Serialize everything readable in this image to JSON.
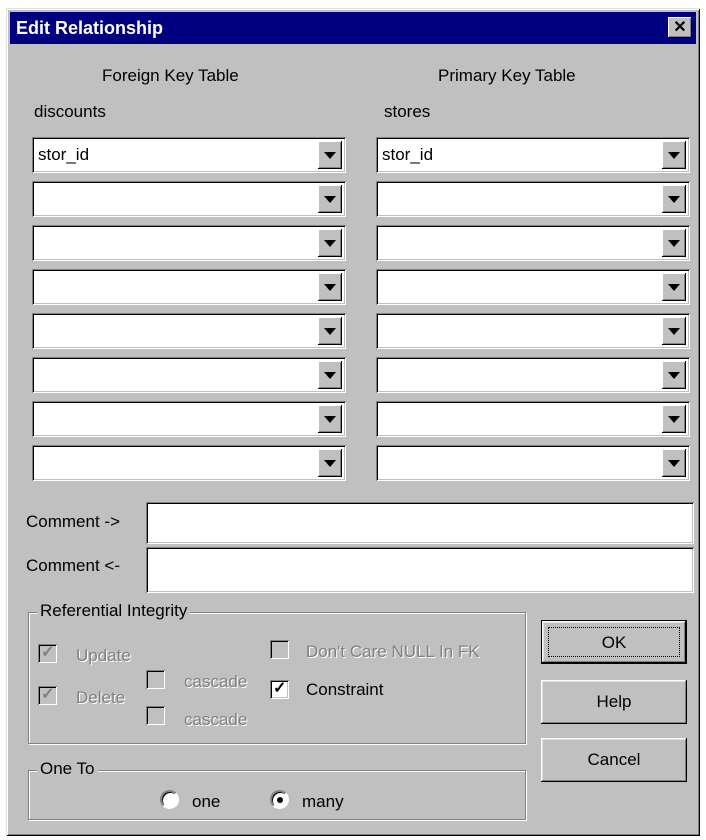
{
  "window": {
    "title": "Edit Relationship",
    "close_glyph": "✕"
  },
  "foreign": {
    "header": "Foreign Key Table",
    "table": "discounts",
    "columns": [
      "stor_id",
      "",
      "",
      "",
      "",
      "",
      "",
      ""
    ]
  },
  "primary": {
    "header": "Primary Key Table",
    "table": "stores",
    "columns": [
      "stor_id",
      "",
      "",
      "",
      "",
      "",
      "",
      ""
    ]
  },
  "comments": {
    "forward_label": "Comment ->",
    "forward_value": "",
    "backward_label": "Comment <-",
    "backward_value": ""
  },
  "referential": {
    "title": "Referential Integrity",
    "update": {
      "label": "Update",
      "checked": true,
      "enabled": false
    },
    "delete": {
      "label": "Delete",
      "checked": true,
      "enabled": false
    },
    "cascade_update": {
      "label": "cascade",
      "checked": false,
      "enabled": false
    },
    "cascade_delete": {
      "label": "cascade",
      "checked": false,
      "enabled": false
    },
    "dont_care_null": {
      "label": "Don't Care NULL In FK",
      "checked": false,
      "enabled": false
    },
    "constraint": {
      "label": "Constraint",
      "checked": true,
      "enabled": true
    }
  },
  "one_to": {
    "title": "One To",
    "options": [
      "one",
      "many"
    ],
    "selected": "many"
  },
  "buttons": {
    "ok": "OK",
    "help": "Help",
    "cancel": "Cancel"
  }
}
